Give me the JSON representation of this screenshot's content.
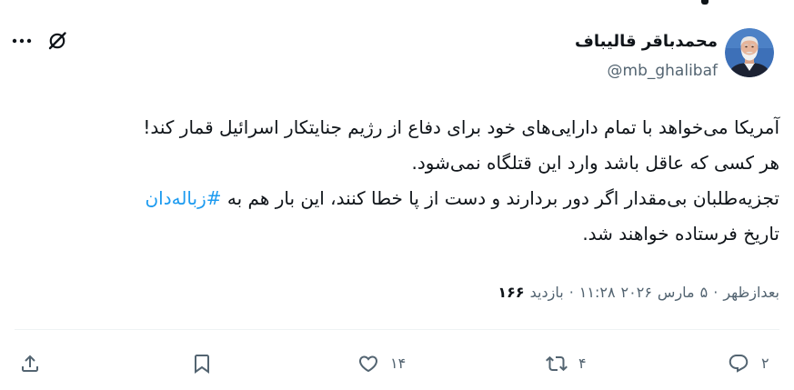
{
  "author": {
    "display_name": "محمدباقر قالیباف",
    "handle": "@mb_ghalibaf",
    "avatar_icon": "profile-photo"
  },
  "header_actions": {
    "more_icon": "more-dots-icon",
    "grok_icon": "grok-icon"
  },
  "tweet": {
    "lines": [
      {
        "text": "آمریکا می‌خواهد با تمام دارایی‌های خود برای دفاع از رژیم جنایتکار اسرائیل قمار کند!"
      },
      {
        "text": "هر کسی که عاقل باشد وارد این قتلگاه نمی‌شود."
      },
      {
        "text": "تجزیه‌طلبان بی‌مقدار اگر دور بردارند و دست از پا خطا کنند، این بار هم به"
      },
      {
        "text": "تاریخ فرستاده خواهند شد."
      }
    ],
    "hashtag": "#زباله‌دان"
  },
  "meta": {
    "period": "بعدازظهر",
    "separator": "·",
    "day": "۵",
    "month": "مارس",
    "year": "۲۰۲۶",
    "time": "۱۱:۲۸",
    "views_label": "بازدید",
    "views_count": "۱۶۶"
  },
  "actions": {
    "reply": {
      "icon": "reply-icon",
      "count": "۲"
    },
    "retweet": {
      "icon": "retweet-icon",
      "count": "۴"
    },
    "like": {
      "icon": "heart-icon",
      "count": "۱۴"
    },
    "bookmark": {
      "icon": "bookmark-icon"
    },
    "share": {
      "icon": "share-icon"
    }
  },
  "colors": {
    "text": "#0f1419",
    "secondary": "#536471",
    "link": "#1d9bf0",
    "divider": "#eff3f4",
    "background": "#ffffff"
  }
}
